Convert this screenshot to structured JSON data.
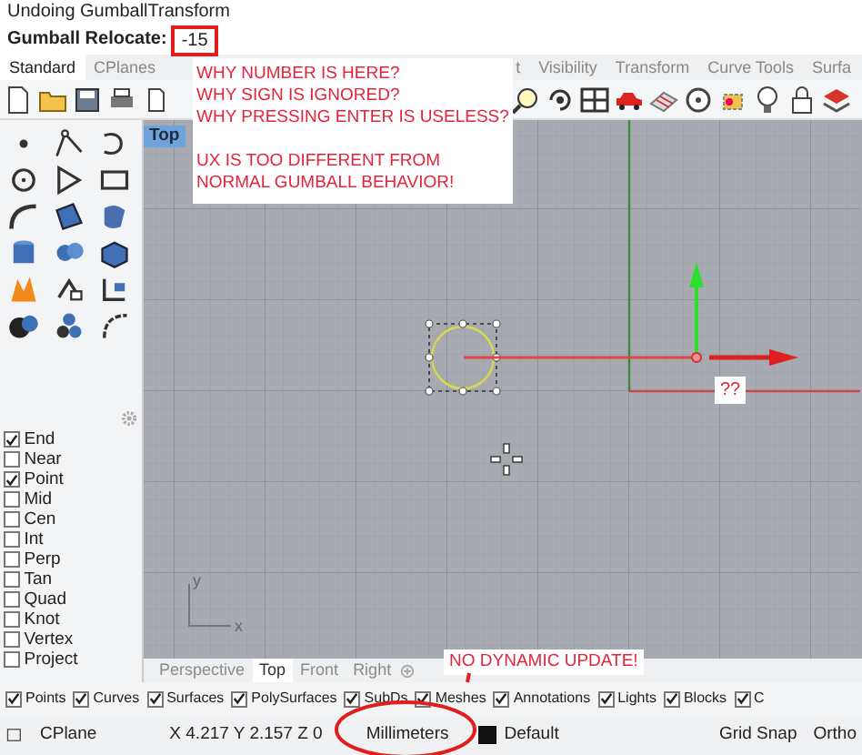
{
  "title_bar": {
    "text": "Undoing GumballTransform"
  },
  "command_line": {
    "prompt": "Gumball Relocate:",
    "value": "-15"
  },
  "toolbar_tabs": [
    {
      "label": "Standard",
      "selected": true
    },
    {
      "label": "CPlanes",
      "selected": false
    },
    {
      "label": "t",
      "selected": false
    },
    {
      "label": "Visibility",
      "selected": false
    },
    {
      "label": "Transform",
      "selected": false
    },
    {
      "label": "Curve Tools",
      "selected": false
    },
    {
      "label": "Surfa",
      "selected": false
    }
  ],
  "viewport": {
    "title": "Top",
    "axis_labels": [
      "y",
      "x"
    ]
  },
  "osnaps": [
    {
      "label": "End",
      "checked": true
    },
    {
      "label": "Near",
      "checked": false
    },
    {
      "label": "Point",
      "checked": true
    },
    {
      "label": "Mid",
      "checked": false
    },
    {
      "label": "Cen",
      "checked": false
    },
    {
      "label": "Int",
      "checked": false
    },
    {
      "label": "Perp",
      "checked": false
    },
    {
      "label": "Tan",
      "checked": false
    },
    {
      "label": "Quad",
      "checked": false
    },
    {
      "label": "Knot",
      "checked": false
    },
    {
      "label": "Vertex",
      "checked": false
    },
    {
      "label": "Project",
      "checked": false
    }
  ],
  "viewport_tabs": [
    {
      "label": "Perspective",
      "selected": false
    },
    {
      "label": "Top",
      "selected": true
    },
    {
      "label": "Front",
      "selected": false
    },
    {
      "label": "Right",
      "selected": false
    }
  ],
  "filters": [
    {
      "label": "Points",
      "checked": true
    },
    {
      "label": "Curves",
      "checked": true
    },
    {
      "label": "Surfaces",
      "checked": true
    },
    {
      "label": "PolySurfaces",
      "checked": true
    },
    {
      "label": "SubDs",
      "checked": true
    },
    {
      "label": "Meshes",
      "checked": true
    },
    {
      "label": "Annotations",
      "checked": true
    },
    {
      "label": "Lights",
      "checked": true
    },
    {
      "label": "Blocks",
      "checked": true
    },
    {
      "label": "C",
      "checked": true
    }
  ],
  "status_bar": {
    "cplane": "CPlane",
    "coordinates": "X 4.217 Y 2.157 Z 0",
    "units": "Millimeters",
    "layer": "Default",
    "toggles": [
      "Grid Snap",
      "Ortho"
    ]
  },
  "annotations": {
    "note_lines": [
      "WHY NUMBER IS HERE?",
      "WHY SIGN IS IGNORED?",
      "WHY PRESSING ENTER IS USELESS?",
      "UX IS TOO DIFFERENT FROM NORMAL GUMBALL BEHAVIOR!"
    ],
    "gumball_note": "??",
    "units_note": "NO DYNAMIC UPDATE!"
  }
}
